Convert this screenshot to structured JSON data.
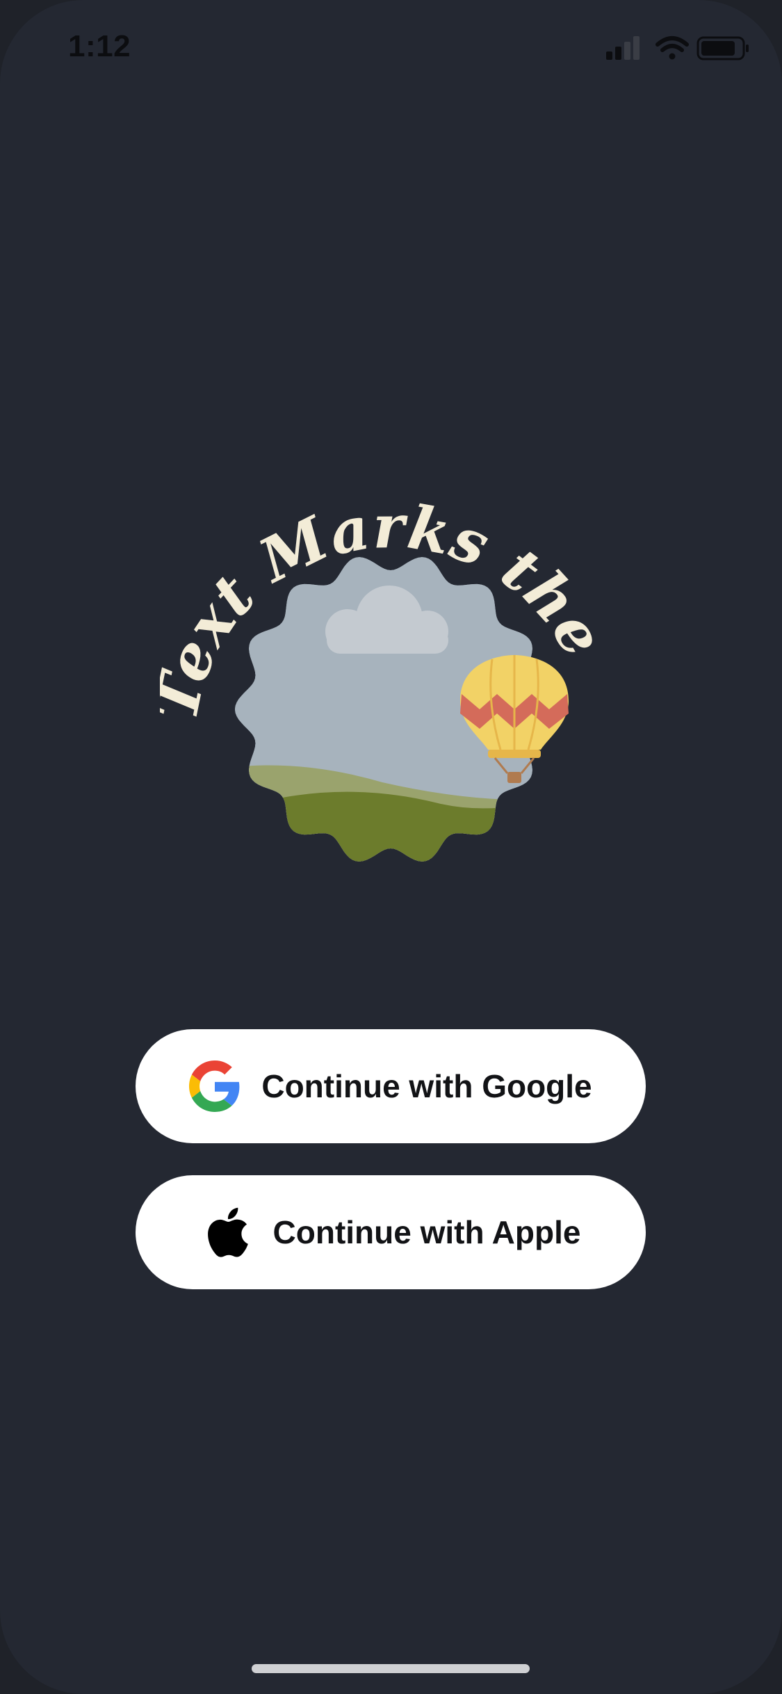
{
  "status_bar": {
    "time": "1:12",
    "icons": [
      "cellular-signal-icon",
      "wifi-icon",
      "battery-icon"
    ]
  },
  "logo": {
    "wordmark": "Text Marks the Spot",
    "illustration": [
      "cloud-icon",
      "hot-air-balloon-icon",
      "hills"
    ]
  },
  "auth": {
    "google": {
      "label": "Continue with Google",
      "icon": "google-logo-icon"
    },
    "apple": {
      "label": "Continue with Apple",
      "icon": "apple-logo-icon"
    }
  },
  "colors": {
    "background": "#242832",
    "wordmark": "#f3ecd7",
    "button_bg": "#ffffff",
    "button_text": "#121316",
    "sky": "#a7b3bd",
    "grass_dark": "#6c7c2c",
    "grass_light": "#9aa36d",
    "balloon_yellow": "#f2d266",
    "balloon_red": "#d46b5a"
  }
}
